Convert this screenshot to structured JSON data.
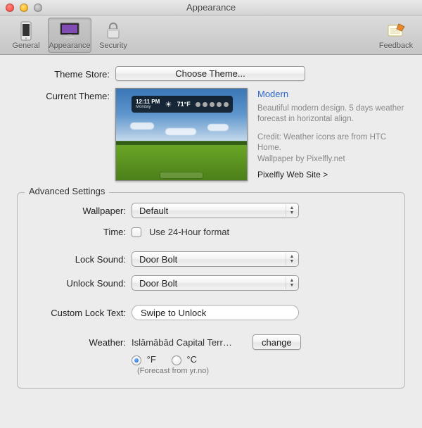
{
  "window": {
    "title": "Appearance"
  },
  "toolbar": {
    "items": [
      {
        "label": "General"
      },
      {
        "label": "Appearance"
      },
      {
        "label": "Security"
      }
    ],
    "feedback": "Feedback"
  },
  "theme": {
    "store_label": "Theme Store:",
    "choose_button": "Choose Theme...",
    "current_label": "Current Theme:",
    "name": "Modern",
    "desc": "Beautiful modern design. 5 days weather forecast in horizontal align.",
    "credit": "Credit: Weather icons are from HTC Home.",
    "wallpaper_by": "Wallpaper by Pixelfly.net",
    "link": "Pixelfly Web Site >",
    "preview_clock": "12:11 PM",
    "preview_day": "Monday",
    "preview_temp": "71°F"
  },
  "advanced": {
    "legend": "Advanced Settings",
    "wallpaper_label": "Wallpaper:",
    "wallpaper_value": "Default",
    "time_label": "Time:",
    "time_checkbox": "Use 24-Hour format",
    "lock_label": "Lock Sound:",
    "lock_value": "Door Bolt",
    "unlock_label": "Unlock Sound:",
    "unlock_value": "Door Bolt",
    "custom_label": "Custom Lock Text:",
    "custom_value": "Swipe to Unlock",
    "weather_label": "Weather:",
    "weather_location": "Islāmābād Capital Terr…",
    "weather_change": "change",
    "unit_f": "°F",
    "unit_c": "°C",
    "forecast_note": "(Forecast from yr.no)"
  }
}
